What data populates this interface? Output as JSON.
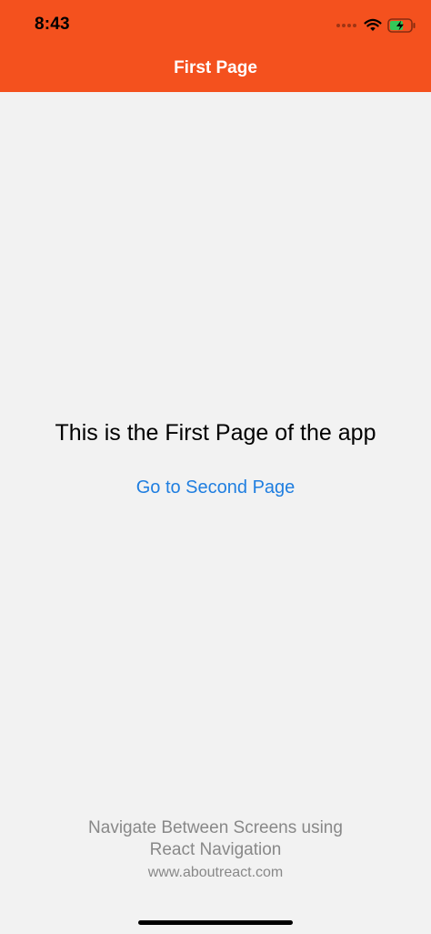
{
  "status_bar": {
    "time": "8:43"
  },
  "header": {
    "title": "First Page",
    "color": "#f4511e"
  },
  "main": {
    "text": "This is the First Page of the app",
    "link_label": "Go to Second Page",
    "link_color": "#1f7ee0"
  },
  "footer": {
    "line1": "Navigate Between Screens using",
    "line2": "React Navigation",
    "url": "www.aboutreact.com"
  },
  "icons": {
    "signal": "cellular-signal-icon",
    "wifi": "wifi-icon",
    "battery": "battery-charging-icon"
  }
}
